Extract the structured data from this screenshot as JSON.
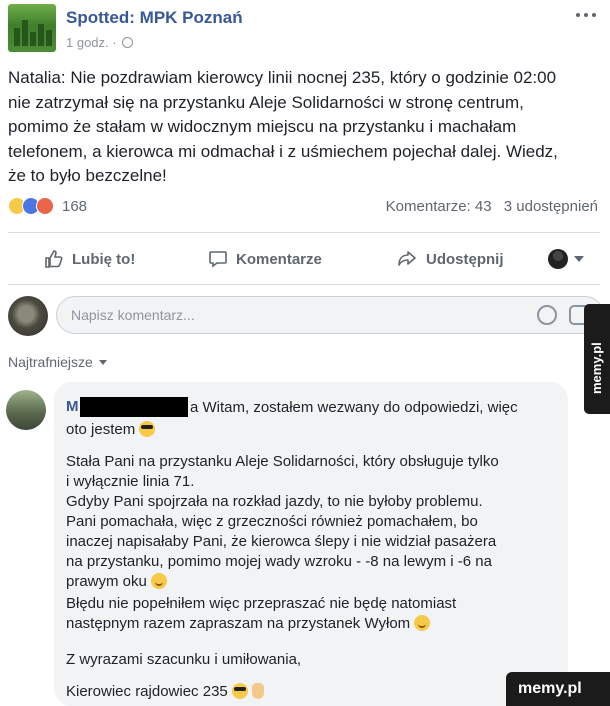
{
  "post": {
    "page_name": "Spotted: MPK Poznań",
    "timestamp": "1 godz. ·",
    "text": "Natalia: Nie pozdrawiam kierowcy linii nocnej 235, który o godzinie 02:00\nnie zatrzymał się na przystanku Aleje Solidarności w stronę centrum,\npomimo że stałam w widocznym miejscu na przystanku i machałam\ntelefonem, a kierowca mi odmachał i z uśmiechem pojechał dalej. Wiedz,\nże to było bezczelne!",
    "reaction_count": "168",
    "comments_count": "Komentarze: 43",
    "shares_count": "3 udostępnień"
  },
  "actions": {
    "like_label": "Lubię to!",
    "comment_label": "Komentarze",
    "share_label": "Udostępnij"
  },
  "composer": {
    "placeholder": "Napisz komentarz..."
  },
  "sort": {
    "label": "Najtrafniejsze"
  },
  "comment": {
    "name_initial": "M",
    "head_line1": "a Witam, zostałem wezwany do odpowiedzi, więc",
    "head_line2": "oto jestem",
    "para1": "Stała Pani na przystanku Aleje Solidarności, który obsługuje tylko\ni wyłącznie linia 71.\nGdyby Pani spojrzała na rozkład jazdy, to nie byłoby problemu.\nPani pomachała, więc z grzeczności również pomachałem, bo\ninaczej napisałaby Pani, że kierowca ślepy i nie widział pasażera\nna przystanku, pomimo mojej wady wzroku - -8 na lewym i -6 na\nprawym oku",
    "para2": "Błędu nie popełniłem więc przepraszać nie będę natomiast\nnastępnym razem zapraszam na przystanek Wyłom",
    "para3": "Z wyrazami szacunku i umiłowania,",
    "para4": "Kierowiec rajdowiec 235"
  },
  "watermarks": {
    "side": "memy.pl",
    "corner": "memy.pl"
  },
  "icons": {
    "like": "thumbs-up-icon",
    "comment": "speech-bubble-icon",
    "share": "share-arrow-icon",
    "emoji": "smiley-icon",
    "sticker": "sticker-icon",
    "more": "more-dots-icon",
    "privacy": "globe-icon"
  }
}
